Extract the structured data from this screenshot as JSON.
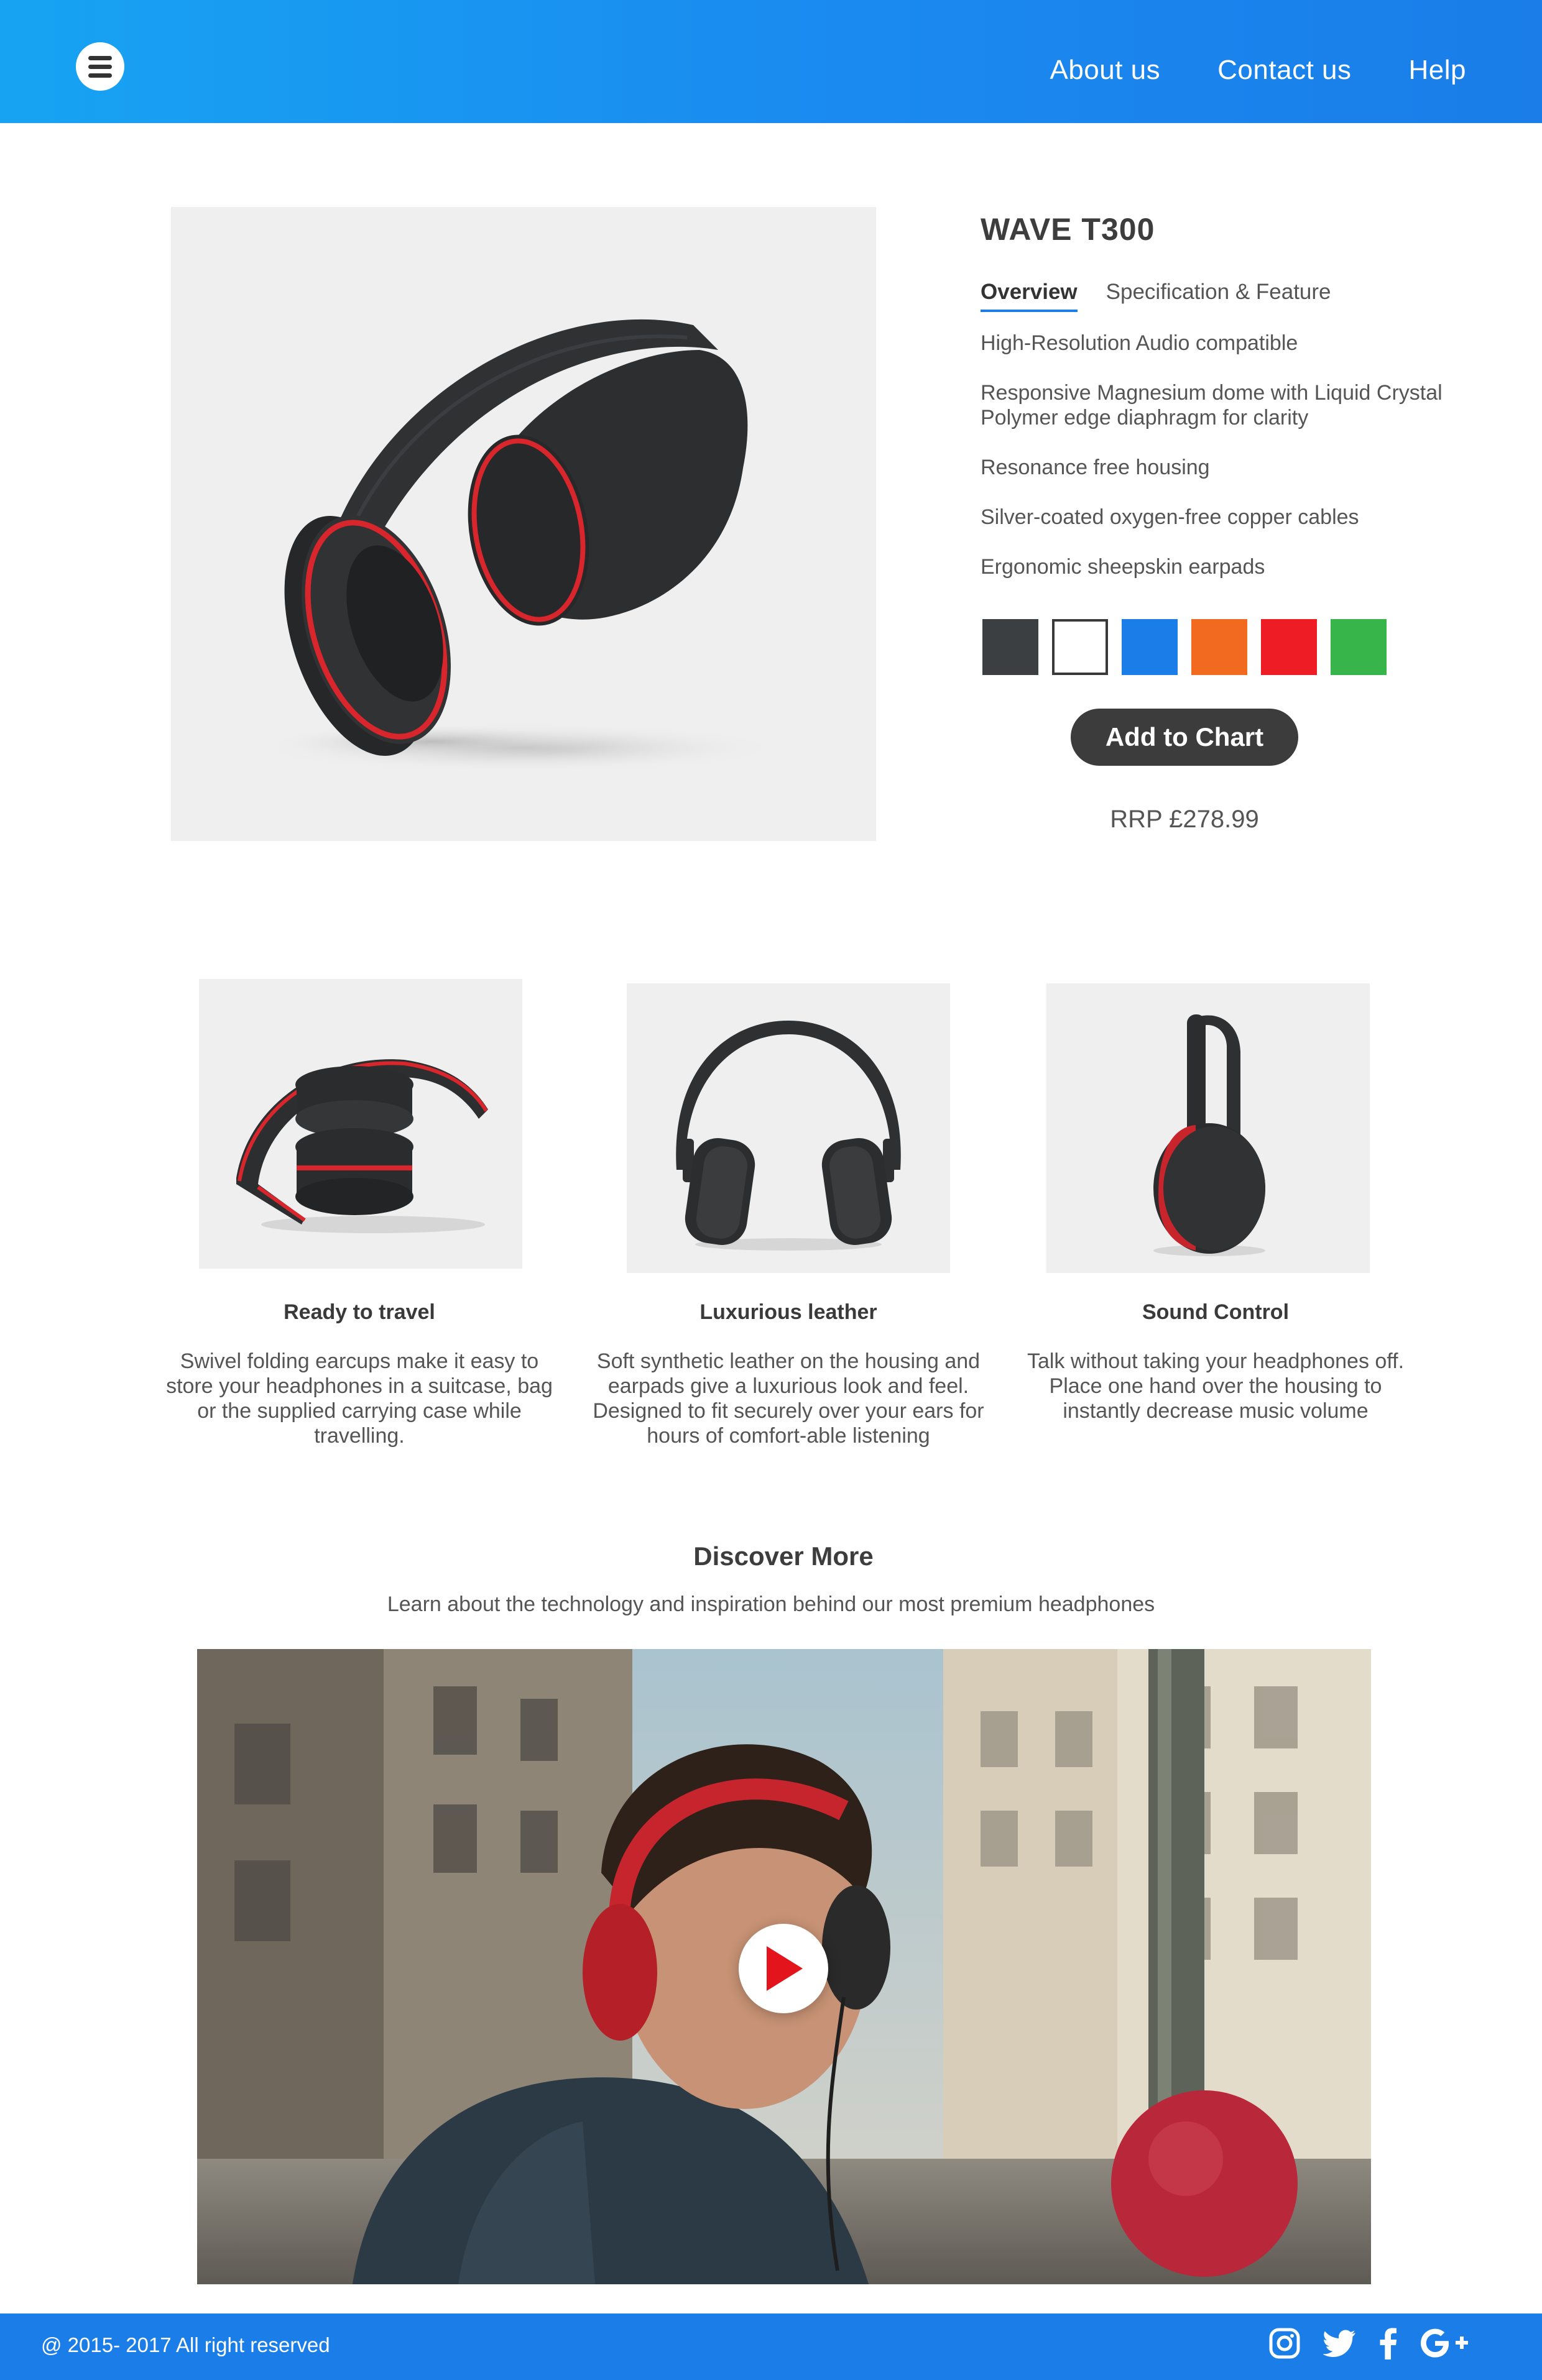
{
  "header": {
    "nav": [
      "About us",
      "Contact us",
      "Help"
    ]
  },
  "product": {
    "name": "WAVE T300",
    "tabs": [
      "Overview",
      "Specification & Feature"
    ],
    "features": [
      "High-Resolution Audio compatible",
      "Responsive Magnesium dome with Liquid Crystal Polymer edge diaphragm for clarity",
      "Resonance free housing",
      "Silver-coated oxygen-free copper cables",
      "Ergonomic sheepskin earpads"
    ],
    "colors": [
      "#3c3f41",
      "#ffffff",
      "#1a7de8",
      "#f26a1f",
      "#ee1c24",
      "#38b54a"
    ],
    "add_button": "Add to Chart",
    "price": "RRP £278.99"
  },
  "cards": [
    {
      "title": "Ready to travel",
      "text": "Swivel folding earcups make it easy to store your headphones in a suitcase, bag or the supplied carrying case while travelling."
    },
    {
      "title": "Luxurious leather",
      "text": "Soft synthetic leather on the housing and earpads give a luxurious look and feel. Designed to fit securely over your ears for hours of comfort-able listening"
    },
    {
      "title": "Sound Control",
      "text": "Talk without taking your headphones off. Place one hand over the housing to instantly decrease music volume"
    }
  ],
  "discover": {
    "title": "Discover More",
    "subtitle": "Learn about the technology and inspiration behind our most premium headphones"
  },
  "footer": {
    "copyright": "@ 2015- 2017  All right reserved",
    "social_icons": [
      "instagram-icon",
      "twitter-icon",
      "facebook-icon",
      "google-plus-icon"
    ]
  },
  "theme": {
    "accent": "#1a7de8",
    "button_dark": "#3c3c3c",
    "play_red": "#e3141c"
  }
}
